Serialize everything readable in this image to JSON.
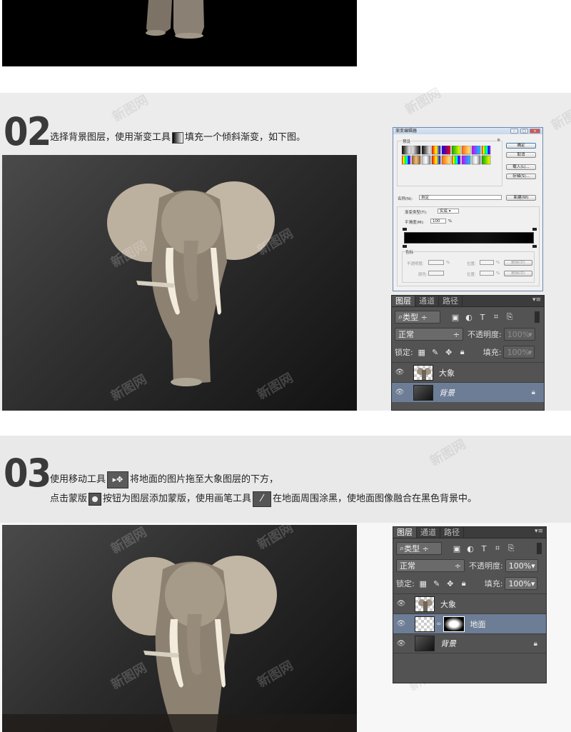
{
  "watermark": "新图网",
  "step2": {
    "number": "02",
    "instruction_before": "选择背景图层，使用渐变工具",
    "instruction_after": "填充一个倾斜渐变，如下图。",
    "tool_icon": "gradient-tool-icon"
  },
  "step3": {
    "number": "03",
    "line1_before": "使用移动工具",
    "line1_after": "将地面的图片拖至大象图层的下方，",
    "line2_a": "点击蒙版",
    "line2_b": "按钮为图层添加蒙版，使用画笔工具",
    "line2_c": "在地面周围涂黑，使地面图像融合在黑色背景中。",
    "tool_icons": [
      "move-tool-icon",
      "mask-button-icon",
      "brush-tool-icon"
    ]
  },
  "gradient_editor": {
    "title": "渐变编辑器",
    "presets_label": "预设",
    "buttons": [
      "确定",
      "取消",
      "载入(L)...",
      "存储(S)..."
    ],
    "name_label": "名称(N):",
    "name_value": "自定",
    "new_button": "新建(W)",
    "type_label": "渐变类型(T):",
    "type_value": "实底",
    "smooth_label": "平滑度(M):",
    "smooth_value": "100",
    "smooth_unit": "%",
    "stops_label": "色标",
    "opacity_label": "不透明度:",
    "color_label": "颜色:",
    "location_label": "位置:",
    "percent": "%",
    "delete_button": "删除(D)"
  },
  "layers_panel_1": {
    "tabs": [
      "图层",
      "通道",
      "路径"
    ],
    "filter": "类型",
    "blend_mode": "正常",
    "opacity_label": "不透明度:",
    "opacity_value": "100%",
    "lock_label": "锁定:",
    "fill_label": "填充:",
    "fill_value": "100%",
    "layers": [
      {
        "name": "大象",
        "selected": false
      },
      {
        "name": "背景",
        "selected": true,
        "locked": true
      }
    ]
  },
  "layers_panel_2": {
    "tabs": [
      "图层",
      "通道",
      "路径"
    ],
    "filter": "类型",
    "blend_mode": "正常",
    "opacity_label": "不透明度:",
    "opacity_value": "100%",
    "lock_label": "锁定:",
    "fill_label": "填充:",
    "fill_value": "100%",
    "layers": [
      {
        "name": "大象",
        "selected": false
      },
      {
        "name": "地面",
        "selected": true
      },
      {
        "name": "背景",
        "selected": false,
        "locked": true
      }
    ]
  },
  "colors": {
    "page_bg": "#eaeaea",
    "canvas_dark": "#1a1a1a",
    "selected_layer": "#6d7d96",
    "panel": "#535353"
  }
}
